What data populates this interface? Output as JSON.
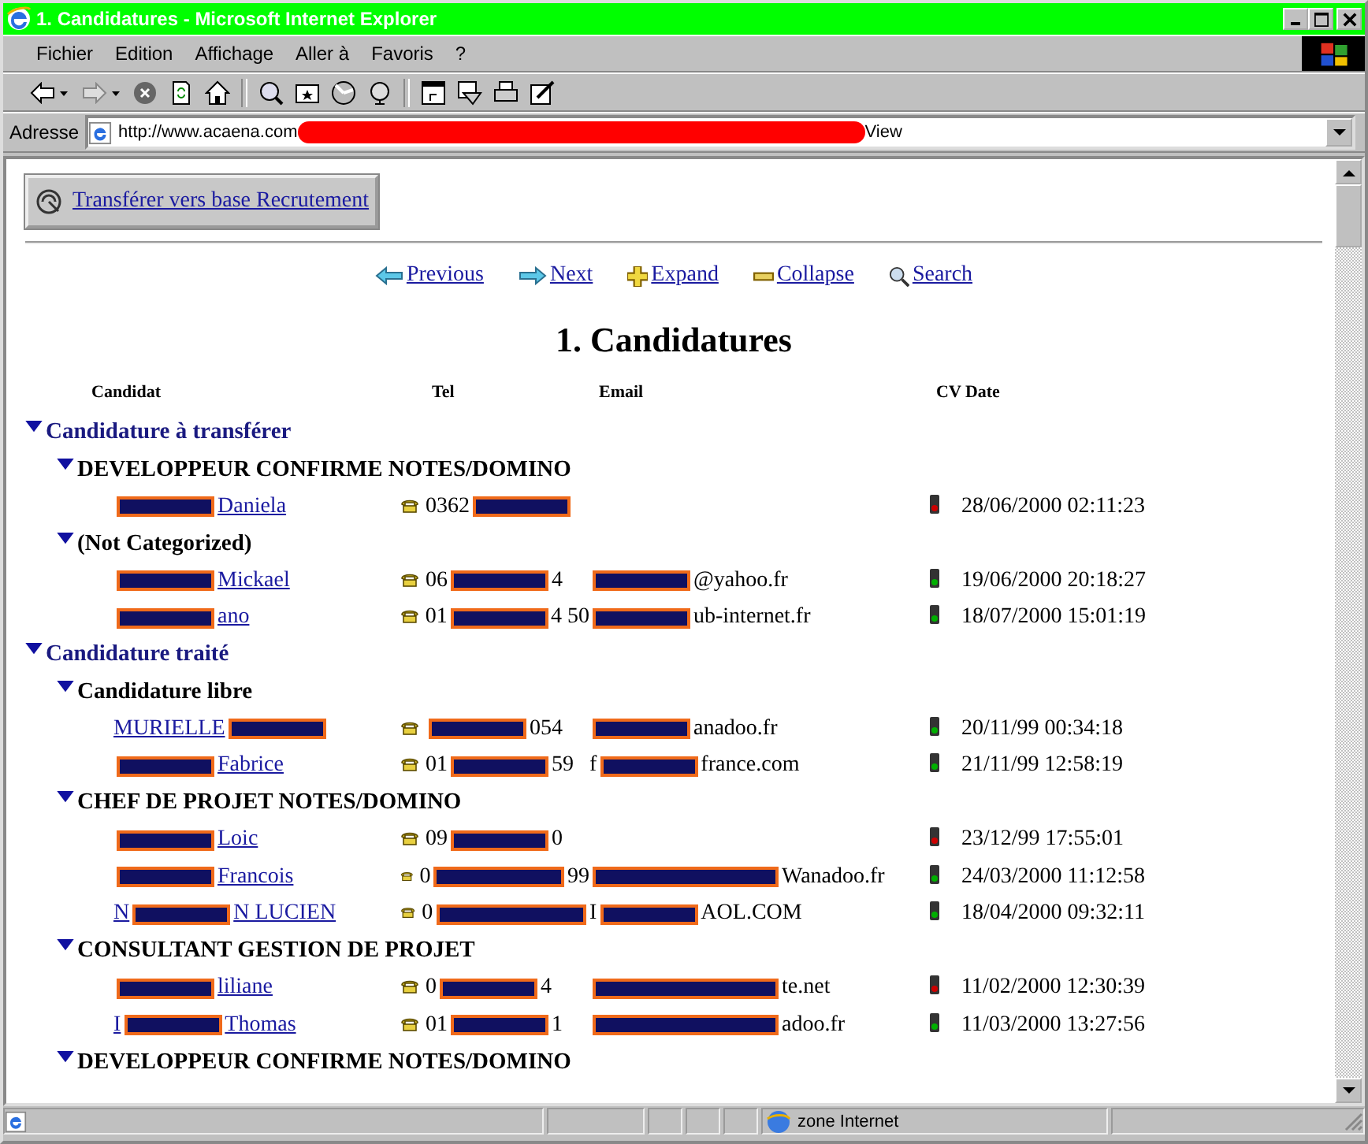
{
  "window": {
    "title": "1. Candidatures - Microsoft Internet Explorer"
  },
  "menu": [
    {
      "label": "Fichier"
    },
    {
      "label": "Edition"
    },
    {
      "label": "Affichage"
    },
    {
      "label": "Aller à"
    },
    {
      "label": "Favoris"
    },
    {
      "label": "?"
    }
  ],
  "address": {
    "label": "Adresse",
    "parts": [
      {
        "kind": "text",
        "text": "http://www.acaena.com"
      },
      {
        "kind": "scribble"
      },
      {
        "kind": "text",
        "text": "View"
      }
    ]
  },
  "transfer_button": {
    "label": "Transférer vers base Recrutement"
  },
  "nav_links": [
    {
      "kind": "previous",
      "label": "Previous"
    },
    {
      "kind": "next",
      "label": "Next"
    },
    {
      "kind": "expand",
      "label": "Expand"
    },
    {
      "kind": "collapse",
      "label": "Collapse"
    },
    {
      "kind": "search",
      "label": "Search"
    }
  ],
  "heading": "1. Candidatures",
  "columns": [
    "Candidat",
    "Tel",
    "Email",
    "CV Date"
  ],
  "groups": [
    {
      "label": "Candidature à transférer",
      "expanded": true,
      "children": [
        {
          "label": "DEVELOPPEUR CONFIRME NOTES/DOMINO",
          "expanded": true,
          "rows": [
            {
              "name": [
                {
                  "kind": "redacted"
                },
                {
                  "kind": "text",
                  "text": "Daniela"
                }
              ],
              "tel": [
                {
                  "kind": "text",
                  "text": "0362"
                },
                {
                  "kind": "redacted"
                }
              ],
              "color": "#cc0000",
              "date": "28/06/2000 02:11:23"
            }
          ]
        },
        {
          "label": "(Not Categorized)",
          "expanded": true,
          "rows": [
            {
              "name": [
                {
                  "kind": "redacted"
                },
                {
                  "kind": "text",
                  "text": " Mickael"
                }
              ],
              "tel": [
                {
                  "kind": "text",
                  "text": "06"
                },
                {
                  "kind": "redacted"
                },
                {
                  "kind": "text",
                  "text": "4"
                }
              ],
              "email": [
                {
                  "kind": "redacted"
                },
                {
                  "kind": "text",
                  "text": "@yahoo.fr"
                }
              ],
              "color": "#00b000",
              "date": "19/06/2000 20:18:27"
            },
            {
              "name": [
                {
                  "kind": "redacted"
                },
                {
                  "kind": "text",
                  "text": "ano"
                }
              ],
              "tel": [
                {
                  "kind": "text",
                  "text": "01"
                },
                {
                  "kind": "redacted"
                },
                {
                  "kind": "text",
                  "text": "4 50"
                }
              ],
              "email": [
                {
                  "kind": "redacted"
                },
                {
                  "kind": "text",
                  "text": "ub-internet.fr"
                }
              ],
              "color": "#00b000",
              "date": "18/07/2000 15:01:19"
            }
          ]
        }
      ]
    },
    {
      "label": "Candidature traité",
      "expanded": true,
      "children": [
        {
          "label": "Candidature libre",
          "expanded": true,
          "rows": [
            {
              "name": [
                {
                  "kind": "text",
                  "text": "MURIELLE"
                },
                {
                  "kind": "redacted"
                }
              ],
              "tel": [
                {
                  "kind": "redacted"
                },
                {
                  "kind": "text",
                  "text": "054"
                }
              ],
              "email": [
                {
                  "kind": "redacted"
                },
                {
                  "kind": "text",
                  "text": "anadoo.fr"
                }
              ],
              "color": "#00b000",
              "date": "20/11/99 00:34:18"
            },
            {
              "name": [
                {
                  "kind": "redacted"
                },
                {
                  "kind": "text",
                  "text": "Fabrice"
                }
              ],
              "tel": [
                {
                  "kind": "text",
                  "text": "01"
                },
                {
                  "kind": "redacted"
                },
                {
                  "kind": "text",
                  "text": "59"
                }
              ],
              "email": [
                {
                  "kind": "text",
                  "text": "f"
                },
                {
                  "kind": "redacted"
                },
                {
                  "kind": "text",
                  "text": "france.com"
                }
              ],
              "color": "#00b000",
              "date": "21/11/99 12:58:19"
            }
          ]
        },
        {
          "label": "CHEF DE PROJET NOTES/DOMINO",
          "expanded": true,
          "rows": [
            {
              "name": [
                {
                  "kind": "redacted"
                },
                {
                  "kind": "text",
                  "text": "Loic"
                }
              ],
              "tel": [
                {
                  "kind": "text",
                  "text": "09"
                },
                {
                  "kind": "redacted"
                },
                {
                  "kind": "text",
                  "text": "0"
                }
              ],
              "color": "#cc0000",
              "date": "23/12/99 17:55:01"
            },
            {
              "name": [
                {
                  "kind": "redacted"
                },
                {
                  "kind": "text",
                  "text": " Francois"
                }
              ],
              "tel": [
                {
                  "kind": "text",
                  "text": "0"
                },
                {
                  "kind": "wide"
                },
                {
                  "kind": "text",
                  "text": "99"
                }
              ],
              "email": [
                {
                  "kind": "wide"
                },
                {
                  "kind": "text",
                  "text": "Wanadoo.fr"
                }
              ],
              "color": "#00b000",
              "date": "24/03/2000 11:12:58"
            },
            {
              "name": [
                {
                  "kind": "text",
                  "text": "N"
                },
                {
                  "kind": "redacted"
                },
                {
                  "kind": "text",
                  "text": "N LUCIEN"
                }
              ],
              "tel": [
                {
                  "kind": "text",
                  "text": "0"
                },
                {
                  "kind": "wide"
                }
              ],
              "email": [
                {
                  "kind": "text",
                  "text": "I"
                },
                {
                  "kind": "redacted"
                },
                {
                  "kind": "text",
                  "text": "AOL.COM"
                }
              ],
              "color": "#00b000",
              "date": "18/04/2000 09:32:11"
            }
          ]
        },
        {
          "label": "CONSULTANT GESTION DE PROJET",
          "expanded": true,
          "rows": [
            {
              "name": [
                {
                  "kind": "redacted"
                },
                {
                  "kind": "text",
                  "text": " liliane"
                }
              ],
              "tel": [
                {
                  "kind": "text",
                  "text": "0"
                },
                {
                  "kind": "redacted"
                },
                {
                  "kind": "text",
                  "text": "4"
                }
              ],
              "email": [
                {
                  "kind": "wide"
                },
                {
                  "kind": "text",
                  "text": "te.net"
                }
              ],
              "color": "#cc0000",
              "date": "11/02/2000 12:30:39"
            },
            {
              "name": [
                {
                  "kind": "text",
                  "text": "I"
                },
                {
                  "kind": "redacted"
                },
                {
                  "kind": "text",
                  "text": "Thomas"
                }
              ],
              "tel": [
                {
                  "kind": "text",
                  "text": "01"
                },
                {
                  "kind": "redacted"
                },
                {
                  "kind": "text",
                  "text": "1"
                }
              ],
              "email": [
                {
                  "kind": "wide"
                },
                {
                  "kind": "text",
                  "text": "adoo.fr"
                }
              ],
              "color": "#00b000",
              "date": "11/03/2000 13:27:56"
            }
          ]
        },
        {
          "label": "DEVELOPPEUR CONFIRME NOTES/DOMINO",
          "expanded": true
        }
      ]
    }
  ],
  "status_bar": {
    "zone": "zone Internet"
  }
}
